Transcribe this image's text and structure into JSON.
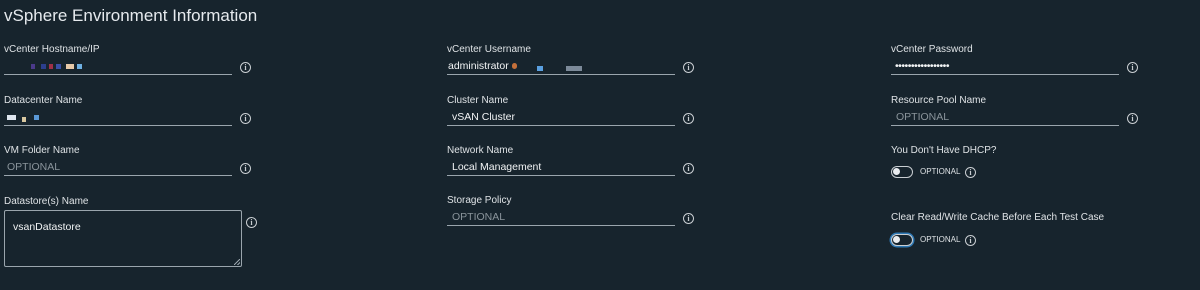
{
  "page": {
    "title": "vSphere Environment Information"
  },
  "fields": {
    "hostname": {
      "label": "vCenter Hostname/IP",
      "value": ""
    },
    "username": {
      "label": "vCenter Username",
      "value": "administrator"
    },
    "password": {
      "label": "vCenter Password",
      "value": "•••••••••••••••••"
    },
    "datacenter": {
      "label": "Datacenter Name",
      "value": ""
    },
    "cluster": {
      "label": "Cluster Name",
      "value": "vSAN Cluster"
    },
    "resource_pool": {
      "label": "Resource Pool Name",
      "placeholder": "OPTIONAL"
    },
    "vm_folder": {
      "label": "VM Folder Name",
      "placeholder": "OPTIONAL"
    },
    "network": {
      "label": "Network Name",
      "value": "Local Management"
    },
    "dhcp": {
      "label": "You Don't Have DHCP?",
      "toggle_label": "OPTIONAL",
      "checked": false
    },
    "datastore": {
      "label": "Datastore(s) Name",
      "value": "vsanDatastore"
    },
    "storage_policy": {
      "label": "Storage Policy",
      "placeholder": "OPTIONAL"
    },
    "clear_cache": {
      "label": "Clear Read/Write Cache Before Each Test Case",
      "toggle_label": "OPTIONAL",
      "checked": false
    }
  },
  "icons": {
    "info": "info-icon",
    "info_glyph": "i"
  },
  "colors": {
    "background": "#17242d",
    "focus_ring": "#2e78b4"
  }
}
